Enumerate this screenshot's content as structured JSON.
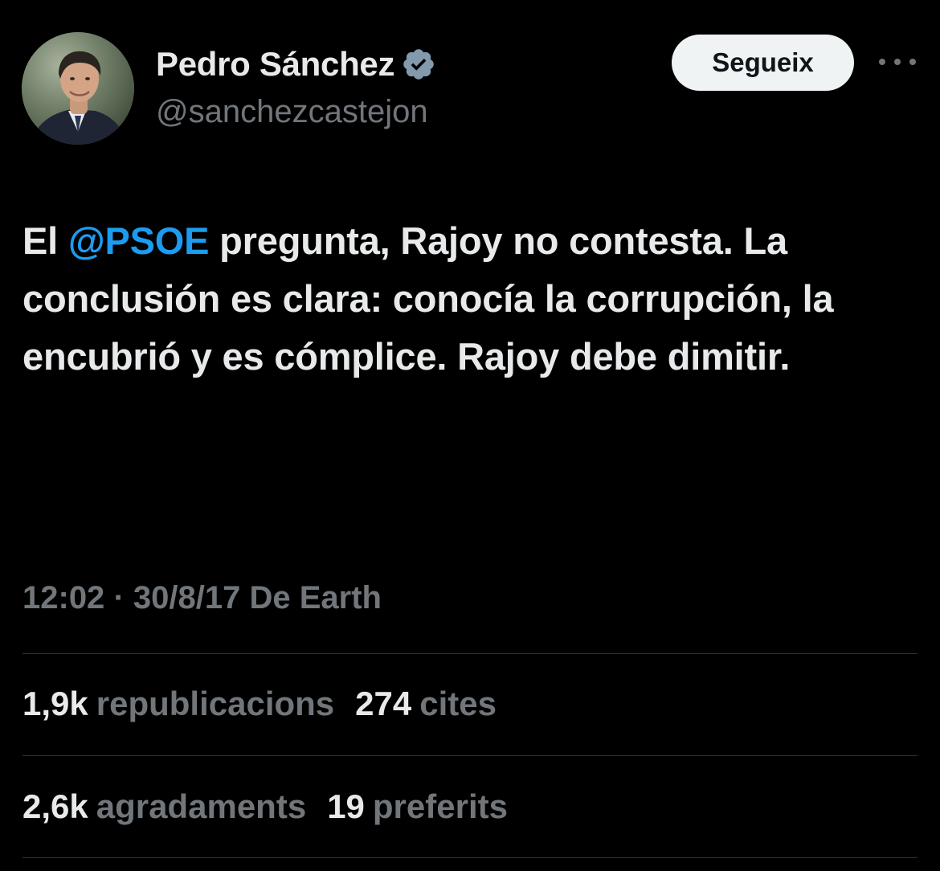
{
  "author": {
    "display_name": "Pedro Sánchez",
    "handle": "@sanchezcastejon",
    "verified_icon": "verified-badge-icon"
  },
  "actions": {
    "follow_label": "Segueix",
    "more_icon": "more-dots-icon"
  },
  "tweet": {
    "prefix": "El ",
    "mention": "@PSOE",
    "body": " pregunta, Rajoy no contesta. La conclusión es clara: conocía la corrupción, la encubrió y es cómplice. Rajoy debe dimitir."
  },
  "meta": {
    "time": "12:02",
    "separator": "·",
    "date": "30/8/17",
    "source": "De Earth"
  },
  "stats": {
    "reposts_value": "1,9k",
    "reposts_label": "republicacions",
    "quotes_value": "274",
    "quotes_label": "cites",
    "likes_value": "2,6k",
    "likes_label": "agradaments",
    "bookmarks_value": "19",
    "bookmarks_label": "preferits"
  },
  "colors": {
    "background": "#000000",
    "text": "#e7e9ea",
    "secondary": "#71767b",
    "link": "#1d9bf0",
    "divider": "#2f3336",
    "button_bg": "#eff3f4"
  }
}
